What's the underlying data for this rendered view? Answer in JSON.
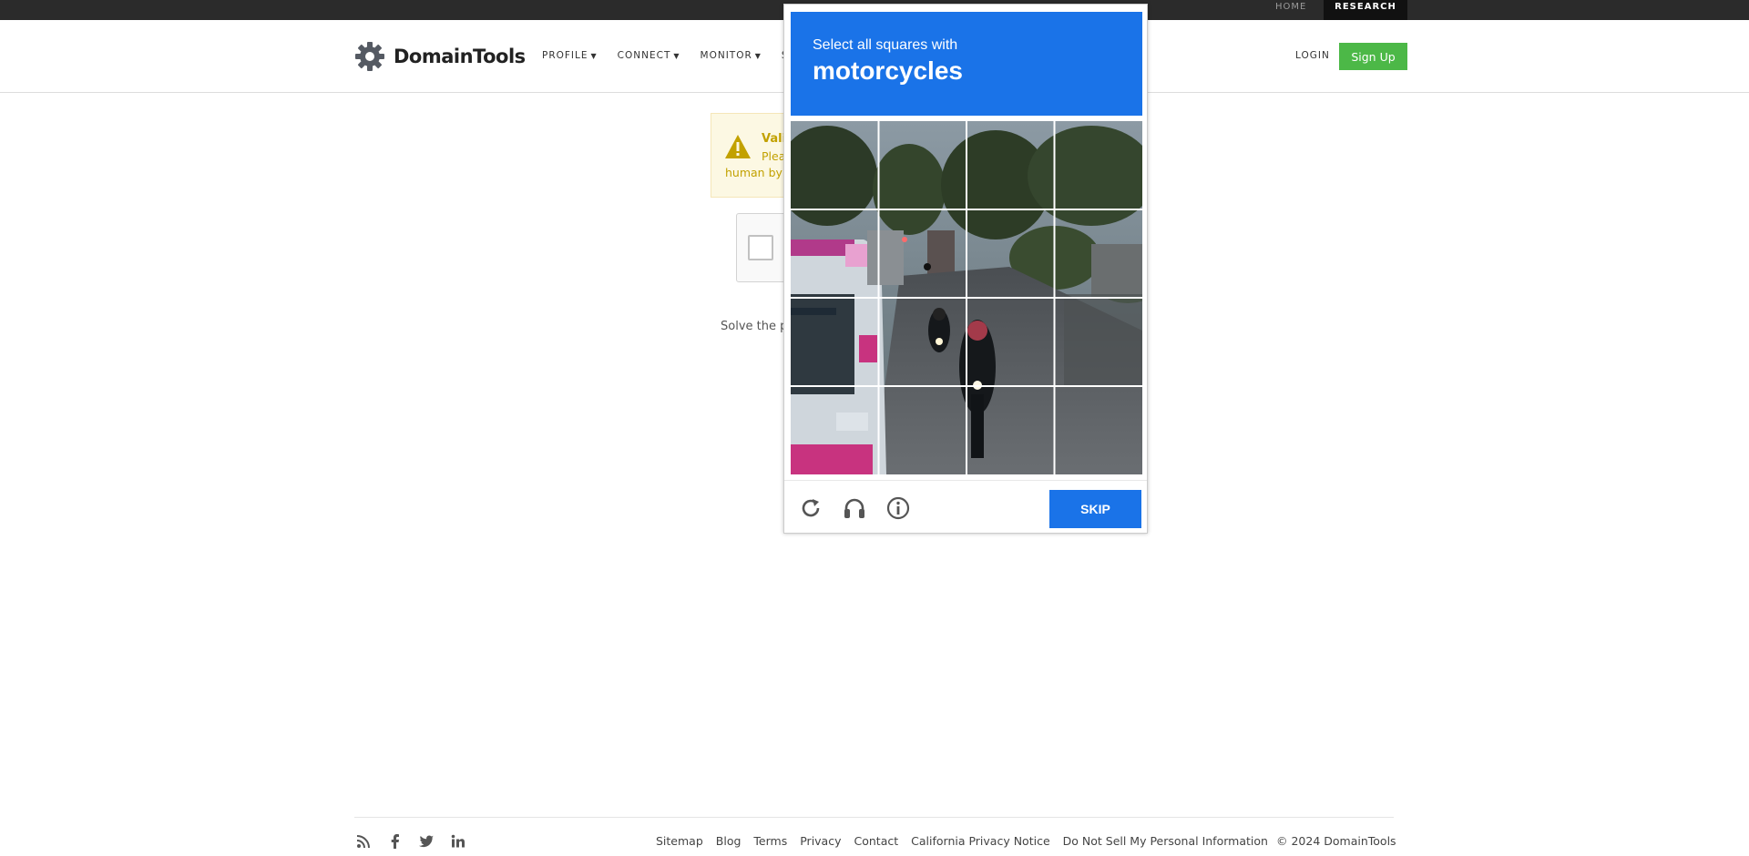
{
  "topbar": {
    "home": "HOME",
    "research": "RESEARCH"
  },
  "header": {
    "logo_text": "DomainTools",
    "nav": [
      "PROFILE",
      "CONNECT",
      "MONITOR",
      "S"
    ],
    "login": "LOGIN",
    "signup": "Sign Up"
  },
  "validation": {
    "title": "Vali",
    "line1": "Plea",
    "line2": "human by",
    "solve_text": "Solve the p"
  },
  "challenge": {
    "instruction": "Select all squares with",
    "target": "motorcycles",
    "skip_label": "SKIP",
    "icons": [
      "reload-icon",
      "audio-icon",
      "info-icon"
    ]
  },
  "footer": {
    "links": [
      "Sitemap",
      "Blog",
      "Terms",
      "Privacy",
      "Contact",
      "California Privacy Notice",
      "Do Not Sell My Personal Information"
    ],
    "copyright": "© 2024 DomainTools",
    "social": [
      "rss-icon",
      "facebook-icon",
      "twitter-icon",
      "linkedin-icon"
    ]
  },
  "colors": {
    "accent": "#1a73e8",
    "signup_green": "#4cb847",
    "warning": "#c2a100"
  }
}
